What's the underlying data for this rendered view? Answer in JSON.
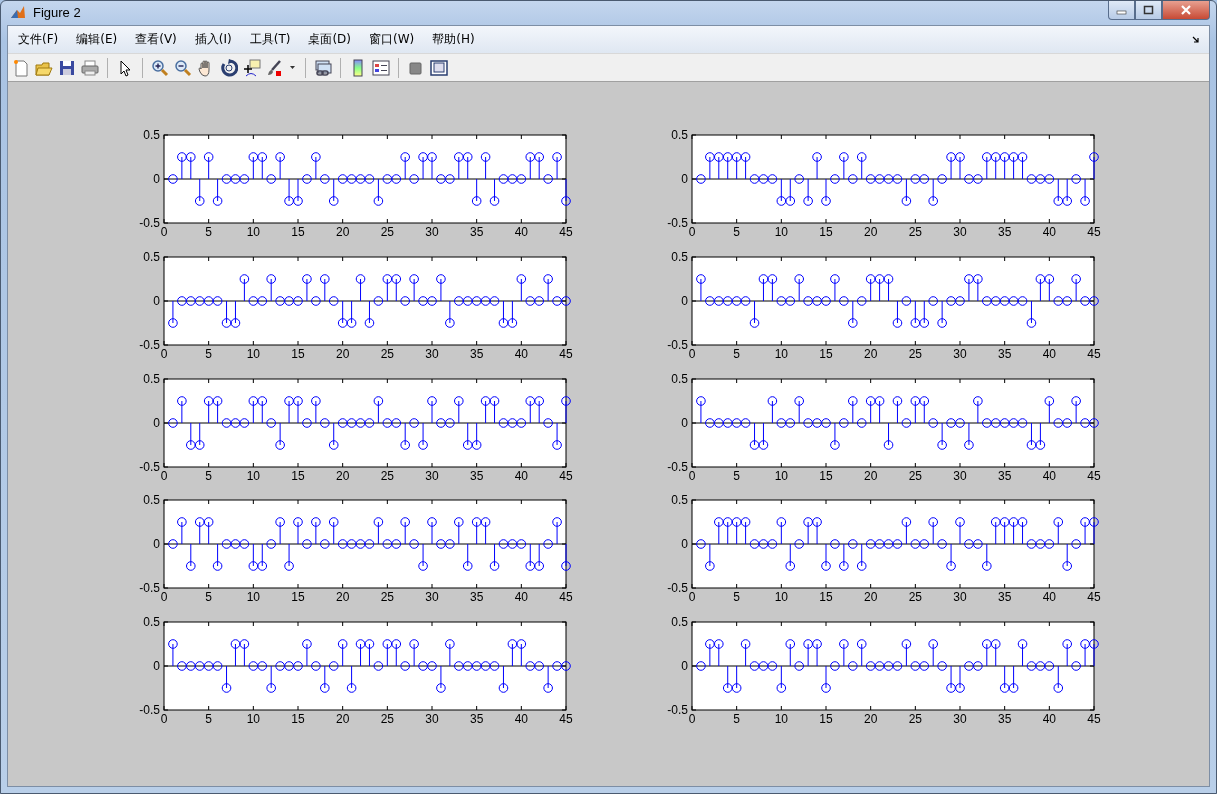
{
  "window": {
    "title": "Figure 2"
  },
  "menu": [
    {
      "label": "文件(F)"
    },
    {
      "label": "编辑(E)"
    },
    {
      "label": "查看(V)"
    },
    {
      "label": "插入(I)"
    },
    {
      "label": "工具(T)"
    },
    {
      "label": "桌面(D)"
    },
    {
      "label": "窗口(W)"
    },
    {
      "label": "帮助(H)"
    }
  ],
  "plots": [
    {
      "chart_data": {
        "type": "scatter",
        "x": [
          1,
          2,
          3,
          4,
          5,
          6,
          7,
          8,
          9,
          10,
          11,
          12,
          13,
          14,
          15,
          16,
          17,
          18,
          19,
          20,
          21,
          22,
          23,
          24,
          25,
          26,
          27,
          28,
          29,
          30,
          31,
          32,
          33,
          34,
          35,
          36,
          37,
          38,
          39,
          40,
          41,
          42,
          43,
          44,
          45
        ],
        "xlim": [
          0,
          45
        ],
        "ylim": [
          -0.5,
          0.5
        ],
        "xticks": [
          0,
          5,
          10,
          15,
          20,
          25,
          30,
          35,
          40,
          45
        ],
        "yticks": [
          -0.5,
          0,
          0.5
        ],
        "series": [
          {
            "color": "#0000ff",
            "values": [
              0,
              0.25,
              0.25,
              -0.25,
              0.25,
              -0.25,
              0,
              0,
              0,
              0.25,
              0.25,
              0,
              0.25,
              -0.25,
              -0.25,
              0,
              0.25,
              0,
              -0.25,
              0,
              0,
              0,
              0,
              -0.25,
              0,
              0,
              0.25,
              0,
              0.25,
              0.25,
              0,
              0,
              0.25,
              0.25,
              -0.25,
              0.25,
              -0.25,
              0,
              0,
              0,
              0.25,
              0.25,
              0,
              0.25,
              -0.25
            ]
          }
        ]
      }
    },
    {
      "chart_data": {
        "type": "scatter",
        "x": [
          1,
          2,
          3,
          4,
          5,
          6,
          7,
          8,
          9,
          10,
          11,
          12,
          13,
          14,
          15,
          16,
          17,
          18,
          19,
          20,
          21,
          22,
          23,
          24,
          25,
          26,
          27,
          28,
          29,
          30,
          31,
          32,
          33,
          34,
          35,
          36,
          37,
          38,
          39,
          40,
          41,
          42,
          43,
          44,
          45
        ],
        "xlim": [
          0,
          45
        ],
        "ylim": [
          -0.5,
          0.5
        ],
        "xticks": [
          0,
          5,
          10,
          15,
          20,
          25,
          30,
          35,
          40,
          45
        ],
        "yticks": [
          -0.5,
          0,
          0.5
        ],
        "series": [
          {
            "color": "#0000ff",
            "values": [
              0,
              0.25,
              0.25,
              0.25,
              0.25,
              0.25,
              0,
              0,
              0,
              -0.25,
              -0.25,
              0,
              -0.25,
              0.25,
              -0.25,
              0,
              0.25,
              0,
              0.25,
              0,
              0,
              0,
              0,
              -0.25,
              0,
              0,
              -0.25,
              0,
              0.25,
              0.25,
              0,
              0,
              0.25,
              0.25,
              0.25,
              0.25,
              0.25,
              0,
              0,
              0,
              -0.25,
              -0.25,
              0,
              -0.25,
              0.25
            ]
          }
        ]
      }
    },
    {
      "chart_data": {
        "type": "scatter",
        "x": [
          1,
          2,
          3,
          4,
          5,
          6,
          7,
          8,
          9,
          10,
          11,
          12,
          13,
          14,
          15,
          16,
          17,
          18,
          19,
          20,
          21,
          22,
          23,
          24,
          25,
          26,
          27,
          28,
          29,
          30,
          31,
          32,
          33,
          34,
          35,
          36,
          37,
          38,
          39,
          40,
          41,
          42,
          43,
          44,
          45
        ],
        "xlim": [
          0,
          45
        ],
        "ylim": [
          -0.5,
          0.5
        ],
        "xticks": [
          0,
          5,
          10,
          15,
          20,
          25,
          30,
          35,
          40,
          45
        ],
        "yticks": [
          -0.5,
          0,
          0.5
        ],
        "series": [
          {
            "color": "#0000ff",
            "values": [
              -0.25,
              0,
              0,
              0,
              0,
              0,
              -0.25,
              -0.25,
              0.25,
              0,
              0,
              0.25,
              0,
              0,
              0,
              0.25,
              0,
              0.25,
              0,
              -0.25,
              -0.25,
              0.25,
              -0.25,
              0,
              0.25,
              0.25,
              0,
              0.25,
              0,
              0,
              0.25,
              -0.25,
              0,
              0,
              0,
              0,
              0,
              -0.25,
              -0.25,
              0.25,
              0,
              0,
              0.25,
              0,
              0
            ]
          }
        ]
      }
    },
    {
      "chart_data": {
        "type": "scatter",
        "x": [
          1,
          2,
          3,
          4,
          5,
          6,
          7,
          8,
          9,
          10,
          11,
          12,
          13,
          14,
          15,
          16,
          17,
          18,
          19,
          20,
          21,
          22,
          23,
          24,
          25,
          26,
          27,
          28,
          29,
          30,
          31,
          32,
          33,
          34,
          35,
          36,
          37,
          38,
          39,
          40,
          41,
          42,
          43,
          44,
          45
        ],
        "xlim": [
          0,
          45
        ],
        "ylim": [
          -0.5,
          0.5
        ],
        "xticks": [
          0,
          5,
          10,
          15,
          20,
          25,
          30,
          35,
          40,
          45
        ],
        "yticks": [
          -0.5,
          0,
          0.5
        ],
        "series": [
          {
            "color": "#0000ff",
            "values": [
              0.25,
              0,
              0,
              0,
              0,
              0,
              -0.25,
              0.25,
              0.25,
              0,
              0,
              0.25,
              0,
              0,
              0,
              0.25,
              0,
              -0.25,
              0,
              0.25,
              0.25,
              0.25,
              -0.25,
              0,
              -0.25,
              -0.25,
              0,
              -0.25,
              0,
              0,
              0.25,
              0.25,
              0,
              0,
              0,
              0,
              0,
              -0.25,
              0.25,
              0.25,
              0,
              0,
              0.25,
              0,
              0
            ]
          }
        ]
      }
    },
    {
      "chart_data": {
        "type": "scatter",
        "x": [
          1,
          2,
          3,
          4,
          5,
          6,
          7,
          8,
          9,
          10,
          11,
          12,
          13,
          14,
          15,
          16,
          17,
          18,
          19,
          20,
          21,
          22,
          23,
          24,
          25,
          26,
          27,
          28,
          29,
          30,
          31,
          32,
          33,
          34,
          35,
          36,
          37,
          38,
          39,
          40,
          41,
          42,
          43,
          44,
          45
        ],
        "xlim": [
          0,
          45
        ],
        "ylim": [
          -0.5,
          0.5
        ],
        "xticks": [
          0,
          5,
          10,
          15,
          20,
          25,
          30,
          35,
          40,
          45
        ],
        "yticks": [
          -0.5,
          0,
          0.5
        ],
        "series": [
          {
            "color": "#0000ff",
            "values": [
              0,
              0.25,
              -0.25,
              -0.25,
              0.25,
              0.25,
              0,
              0,
              0,
              0.25,
              0.25,
              0,
              -0.25,
              0.25,
              0.25,
              0,
              0.25,
              0,
              -0.25,
              0,
              0,
              0,
              0,
              0.25,
              0,
              0,
              -0.25,
              0,
              -0.25,
              0.25,
              0,
              0,
              0.25,
              -0.25,
              -0.25,
              0.25,
              0.25,
              0,
              0,
              0,
              0.25,
              0.25,
              0,
              -0.25,
              0.25
            ]
          }
        ]
      }
    },
    {
      "chart_data": {
        "type": "scatter",
        "x": [
          1,
          2,
          3,
          4,
          5,
          6,
          7,
          8,
          9,
          10,
          11,
          12,
          13,
          14,
          15,
          16,
          17,
          18,
          19,
          20,
          21,
          22,
          23,
          24,
          25,
          26,
          27,
          28,
          29,
          30,
          31,
          32,
          33,
          34,
          35,
          36,
          37,
          38,
          39,
          40,
          41,
          42,
          43,
          44,
          45
        ],
        "xlim": [
          0,
          45
        ],
        "ylim": [
          -0.5,
          0.5
        ],
        "xticks": [
          0,
          5,
          10,
          15,
          20,
          25,
          30,
          35,
          40,
          45
        ],
        "yticks": [
          -0.5,
          0,
          0.5
        ],
        "series": [
          {
            "color": "#0000ff",
            "values": [
              0.25,
              0,
              0,
              0,
              0,
              0,
              -0.25,
              -0.25,
              0.25,
              0,
              0,
              0.25,
              0,
              0,
              0,
              -0.25,
              0,
              0.25,
              0,
              0.25,
              0.25,
              -0.25,
              0.25,
              0,
              0.25,
              0.25,
              0,
              -0.25,
              0,
              0,
              -0.25,
              0.25,
              0,
              0,
              0,
              0,
              0,
              -0.25,
              -0.25,
              0.25,
              0,
              0,
              0.25,
              0,
              0
            ]
          }
        ]
      }
    },
    {
      "chart_data": {
        "type": "scatter",
        "x": [
          1,
          2,
          3,
          4,
          5,
          6,
          7,
          8,
          9,
          10,
          11,
          12,
          13,
          14,
          15,
          16,
          17,
          18,
          19,
          20,
          21,
          22,
          23,
          24,
          25,
          26,
          27,
          28,
          29,
          30,
          31,
          32,
          33,
          34,
          35,
          36,
          37,
          38,
          39,
          40,
          41,
          42,
          43,
          44,
          45
        ],
        "xlim": [
          0,
          45
        ],
        "ylim": [
          -0.5,
          0.5
        ],
        "xticks": [
          0,
          5,
          10,
          15,
          20,
          25,
          30,
          35,
          40,
          45
        ],
        "yticks": [
          -0.5,
          0,
          0.5
        ],
        "series": [
          {
            "color": "#0000ff",
            "values": [
              0,
              0.25,
              -0.25,
              0.25,
              0.25,
              -0.25,
              0,
              0,
              0,
              -0.25,
              -0.25,
              0,
              0.25,
              -0.25,
              0.25,
              0,
              0.25,
              0,
              0.25,
              0,
              0,
              0,
              0,
              0.25,
              0,
              0,
              0.25,
              0,
              -0.25,
              0.25,
              0,
              0,
              0.25,
              -0.25,
              0.25,
              0.25,
              -0.25,
              0,
              0,
              0,
              -0.25,
              -0.25,
              0,
              0.25,
              -0.25
            ]
          }
        ]
      }
    },
    {
      "chart_data": {
        "type": "scatter",
        "x": [
          1,
          2,
          3,
          4,
          5,
          6,
          7,
          8,
          9,
          10,
          11,
          12,
          13,
          14,
          15,
          16,
          17,
          18,
          19,
          20,
          21,
          22,
          23,
          24,
          25,
          26,
          27,
          28,
          29,
          30,
          31,
          32,
          33,
          34,
          35,
          36,
          37,
          38,
          39,
          40,
          41,
          42,
          43,
          44,
          45
        ],
        "xlim": [
          0,
          45
        ],
        "ylim": [
          -0.5,
          0.5
        ],
        "xticks": [
          0,
          5,
          10,
          15,
          20,
          25,
          30,
          35,
          40,
          45
        ],
        "yticks": [
          -0.5,
          0,
          0.5
        ],
        "series": [
          {
            "color": "#0000ff",
            "values": [
              0,
              -0.25,
              0.25,
              0.25,
              0.25,
              0.25,
              0,
              0,
              0,
              0.25,
              -0.25,
              0,
              0.25,
              0.25,
              -0.25,
              0,
              -0.25,
              0,
              -0.25,
              0,
              0,
              0,
              0,
              0.25,
              0,
              0,
              0.25,
              0,
              -0.25,
              0.25,
              0,
              0,
              -0.25,
              0.25,
              0.25,
              0.25,
              0.25,
              0,
              0,
              0,
              0.25,
              -0.25,
              0,
              0.25,
              0.25
            ]
          }
        ]
      }
    },
    {
      "chart_data": {
        "type": "scatter",
        "x": [
          1,
          2,
          3,
          4,
          5,
          6,
          7,
          8,
          9,
          10,
          11,
          12,
          13,
          14,
          15,
          16,
          17,
          18,
          19,
          20,
          21,
          22,
          23,
          24,
          25,
          26,
          27,
          28,
          29,
          30,
          31,
          32,
          33,
          34,
          35,
          36,
          37,
          38,
          39,
          40,
          41,
          42,
          43,
          44,
          45
        ],
        "xlim": [
          0,
          45
        ],
        "ylim": [
          -0.5,
          0.5
        ],
        "xticks": [
          0,
          5,
          10,
          15,
          20,
          25,
          30,
          35,
          40,
          45
        ],
        "yticks": [
          -0.5,
          0,
          0.5
        ],
        "series": [
          {
            "color": "#0000ff",
            "values": [
              0.25,
              0,
              0,
              0,
              0,
              0,
              -0.25,
              0.25,
              0.25,
              0,
              0,
              -0.25,
              0,
              0,
              0,
              0.25,
              0,
              -0.25,
              0,
              0.25,
              -0.25,
              0.25,
              0.25,
              0,
              0.25,
              0.25,
              0,
              0.25,
              0,
              0,
              -0.25,
              0.25,
              0,
              0,
              0,
              0,
              0,
              -0.25,
              0.25,
              0.25,
              0,
              0,
              -0.25,
              0,
              0
            ]
          }
        ]
      }
    },
    {
      "chart_data": {
        "type": "scatter",
        "x": [
          1,
          2,
          3,
          4,
          5,
          6,
          7,
          8,
          9,
          10,
          11,
          12,
          13,
          14,
          15,
          16,
          17,
          18,
          19,
          20,
          21,
          22,
          23,
          24,
          25,
          26,
          27,
          28,
          29,
          30,
          31,
          32,
          33,
          34,
          35,
          36,
          37,
          38,
          39,
          40,
          41,
          42,
          43,
          44,
          45
        ],
        "xlim": [
          0,
          45
        ],
        "ylim": [
          -0.5,
          0.5
        ],
        "xticks": [
          0,
          5,
          10,
          15,
          20,
          25,
          30,
          35,
          40,
          45
        ],
        "yticks": [
          -0.5,
          0,
          0.5
        ],
        "series": [
          {
            "color": "#0000ff",
            "values": [
              0,
              0.25,
              0.25,
              -0.25,
              -0.25,
              0.25,
              0,
              0,
              0,
              -0.25,
              0.25,
              0,
              0.25,
              0.25,
              -0.25,
              0,
              0.25,
              0,
              0.25,
              0,
              0,
              0,
              0,
              0.25,
              0,
              0,
              0.25,
              0,
              -0.25,
              -0.25,
              0,
              0,
              0.25,
              0.25,
              -0.25,
              -0.25,
              0.25,
              0,
              0,
              0,
              -0.25,
              0.25,
              0,
              0.25,
              0.25
            ]
          }
        ]
      }
    }
  ]
}
